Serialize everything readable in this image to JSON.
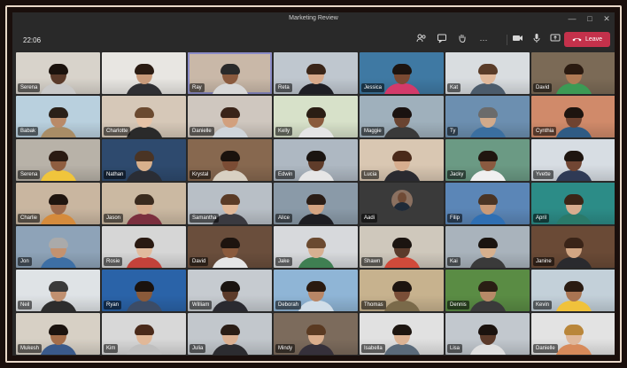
{
  "window": {
    "title": "Marketing Review",
    "controls": [
      "minimize-icon",
      "maximize-icon",
      "close-icon"
    ]
  },
  "toolbar": {
    "time": "22:06",
    "buttons": [
      "people-icon",
      "chat-icon",
      "raise-hand-icon",
      "more-icon",
      "camera-icon",
      "microphone-icon",
      "share-screen-icon"
    ],
    "leave_label": "Leave"
  },
  "accent_colors": {
    "leave": "#c4314b",
    "active_speaker": "#8b8cc7"
  },
  "participants": [
    {
      "name": "Serena",
      "skin": "#5a3a2a",
      "hair": "#1b120d",
      "shirt": "#c9c9c9",
      "bg": "#d8d3cb"
    },
    {
      "name": "",
      "skin": "#c89a7a",
      "hair": "#2a1b12",
      "shirt": "#2f2f33",
      "bg": "#e8e6e2"
    },
    {
      "name": "Ray",
      "skin": "#8a5a3e",
      "hair": "#2a2a2a",
      "shirt": "#d8d8d8",
      "bg": "#c9b8a8"
    },
    {
      "name": "Reta",
      "skin": "#d7a98a",
      "hair": "#3a2518",
      "shirt": "#1e1e24",
      "bg": "#bfc7cf"
    },
    {
      "name": "Jessica",
      "skin": "#7a4a32",
      "hair": "#1d140f",
      "shirt": "#d33a6a",
      "bg": "#3f79a3"
    },
    {
      "name": "Kat",
      "skin": "#e1b99b",
      "hair": "#5a3c28",
      "shirt": "#4c5c6c",
      "bg": "#d9dde0"
    },
    {
      "name": "David",
      "skin": "#b07a55",
      "hair": "#2a1a10",
      "shirt": "#3c9a55",
      "bg": "#7b6a56"
    },
    {
      "name": "Babak",
      "skin": "#b98a68",
      "hair": "#2a2018",
      "shirt": "#a98d66",
      "bg": "#b9d0de"
    },
    {
      "name": "Charlotte",
      "skin": "#e7c4a7",
      "hair": "#6b4a30",
      "shirt": "#2a2a2a",
      "bg": "#d6c8b8"
    },
    {
      "name": "Danielle",
      "skin": "#d2a07e",
      "hair": "#3a2419",
      "shirt": "#cfd5db",
      "bg": "#cfc7bf"
    },
    {
      "name": "Kelly",
      "skin": "#8a5a3c",
      "hair": "#2a1d14",
      "shirt": "#e5e5e5",
      "bg": "#d7e1c9"
    },
    {
      "name": "Maggie",
      "skin": "#6a4431",
      "hair": "#1a1210",
      "shirt": "#3a3a3a",
      "bg": "#9fb0bc"
    },
    {
      "name": "Ty",
      "skin": "#d1aa8b",
      "hair": "#6b6b6b",
      "shirt": "#3b6fa0",
      "bg": "#6c8fb0"
    },
    {
      "name": "Cynthia",
      "skin": "#6f4330",
      "hair": "#1d140f",
      "shirt": "#2f5b84",
      "bg": "#d08a6a"
    },
    {
      "name": "Serena",
      "skin": "#8f5e40",
      "hair": "#2a1a12",
      "shirt": "#f0c53c",
      "bg": "#b8b2a8"
    },
    {
      "name": "Nathan",
      "skin": "#d8b08c",
      "hair": "#4a3424",
      "shirt": "#2a2d35",
      "bg": "#2e4a6e"
    },
    {
      "name": "Krystal",
      "skin": "#7b4c34",
      "hair": "#1a120d",
      "shirt": "#d8d0c2",
      "bg": "#87684f"
    },
    {
      "name": "Edwin",
      "skin": "#5f3c2a",
      "hair": "#1a1410",
      "shirt": "#e6e6e6",
      "bg": "#aeb8c2"
    },
    {
      "name": "Lucia",
      "skin": "#d7ad8e",
      "hair": "#4a2a1a",
      "shirt": "#2a2a30",
      "bg": "#d9c7b2"
    },
    {
      "name": "Jacky",
      "skin": "#8a5a40",
      "hair": "#20150f",
      "shirt": "#f0f0f0",
      "bg": "#6b9a84"
    },
    {
      "name": "Yvette",
      "skin": "#714633",
      "hair": "#1e1510",
      "shirt": "#2f3a55",
      "bg": "#d7dde3"
    },
    {
      "name": "Charlie",
      "skin": "#9d6a4c",
      "hair": "#1f150f",
      "shirt": "#d58b3c",
      "bg": "#c9b6a0"
    },
    {
      "name": "Jason",
      "skin": "#d6ad8d",
      "hair": "#3a2a1e",
      "shirt": "#7b2f3e",
      "bg": "#cbb9a2"
    },
    {
      "name": "Samantha",
      "skin": "#e0b898",
      "hair": "#5a3b26",
      "shirt": "#3a3a40",
      "bg": "#b8bfc6"
    },
    {
      "name": "Alice",
      "skin": "#d4a482",
      "hair": "#2a1d16",
      "shirt": "#1d1d22",
      "bg": "#8a9aa8"
    },
    {
      "name": "Aadi",
      "skin": "#6f4a35",
      "hair": "#1a1410",
      "shirt": "#1f2a38",
      "bg": "#3a3a3a",
      "avatar": true
    },
    {
      "name": "Filip",
      "skin": "#c99a78",
      "hair": "#4a3424",
      "shirt": "#2f6fb3",
      "bg": "#5b86b7"
    },
    {
      "name": "April",
      "skin": "#d8ad8f",
      "hair": "#3b2517",
      "shirt": "#2a7a6a",
      "bg": "#2c8c87"
    },
    {
      "name": "Jon",
      "skin": "#c39270",
      "hair": "#aaaaaa",
      "shirt": "#3d6fa5",
      "bg": "#8ea3b8"
    },
    {
      "name": "Rosie",
      "skin": "#e1bb9d",
      "hair": "#2a1a12",
      "shirt": "#c3423a",
      "bg": "#d6d6d6"
    },
    {
      "name": "David",
      "skin": "#8a5a3c",
      "hair": "#1d140f",
      "shirt": "#e6e6e6",
      "bg": "#6a4e3c"
    },
    {
      "name": "Jake",
      "skin": "#d7b091",
      "hair": "#6b4a30",
      "shirt": "#3f7f52",
      "bg": "#d7d9dc"
    },
    {
      "name": "Shawn",
      "skin": "#5a3b2b",
      "hair": "#1b1410",
      "shirt": "#d04a3a",
      "bg": "#cfc8bc"
    },
    {
      "name": "Kai",
      "skin": "#d6b08e",
      "hair": "#1a1410",
      "shirt": "#3a3a3a",
      "bg": "#a9b3bc"
    },
    {
      "name": "Janine",
      "skin": "#d2a683",
      "hair": "#3a2418",
      "shirt": "#2a2a2e",
      "bg": "#6a4a36"
    },
    {
      "name": "Neil",
      "skin": "#c09070",
      "hair": "#3a3a3a",
      "shirt": "#2d2d2d",
      "bg": "#dfe3e6"
    },
    {
      "name": "Ryan",
      "skin": "#8a5a3a",
      "hair": "#1a120e",
      "shirt": "#3c4c66",
      "bg": "#2a63a8"
    },
    {
      "name": "William",
      "skin": "#5c3b2a",
      "hair": "#1a1410",
      "shirt": "#2a2a30",
      "bg": "#c6cbd0"
    },
    {
      "name": "Deborah",
      "skin": "#b88666",
      "hair": "#2a1a10",
      "shirt": "#d0dde8",
      "bg": "#8fb5d6"
    },
    {
      "name": "Thomas",
      "skin": "#7a4e37",
      "hair": "#1d140f",
      "shirt": "#7a6a4a",
      "bg": "#c7b28e"
    },
    {
      "name": "Dennis",
      "skin": "#b78a68",
      "hair": "#2a1e14",
      "shirt": "#3a3a3a",
      "bg": "#5a8c44"
    },
    {
      "name": "Kevin",
      "skin": "#a97452",
      "hair": "#2a1b12",
      "shirt": "#f0c23b",
      "bg": "#c3d0d9"
    },
    {
      "name": "Mukesh",
      "skin": "#a46e4a",
      "hair": "#1b130e",
      "shirt": "#3a5a8a",
      "bg": "#d7d0c5"
    },
    {
      "name": "Kim",
      "skin": "#e1b898",
      "hair": "#4a2a1a",
      "shirt": "#bfbfbf",
      "bg": "#d8d8d8"
    },
    {
      "name": "Julia",
      "skin": "#dab091",
      "hair": "#2a1d15",
      "shirt": "#2c2c30",
      "bg": "#c2c7cc"
    },
    {
      "name": "Mindy",
      "skin": "#d9ad8c",
      "hair": "#5a3a22",
      "shirt": "#35303a",
      "bg": "#7c6b5c"
    },
    {
      "name": "Isabella",
      "skin": "#dcb394",
      "hair": "#1d1510",
      "shirt": "#5a6a7a",
      "bg": "#e1e1e1"
    },
    {
      "name": "Lisa",
      "skin": "#5b3a2a",
      "hair": "#1a120e",
      "shirt": "#e0e0e0",
      "bg": "#c2c8ce"
    },
    {
      "name": "Danielle",
      "skin": "#e0b89a",
      "hair": "#b9863a",
      "shirt": "#d78a5a",
      "bg": "#e3e3e3"
    }
  ],
  "active_participant_index": 2
}
